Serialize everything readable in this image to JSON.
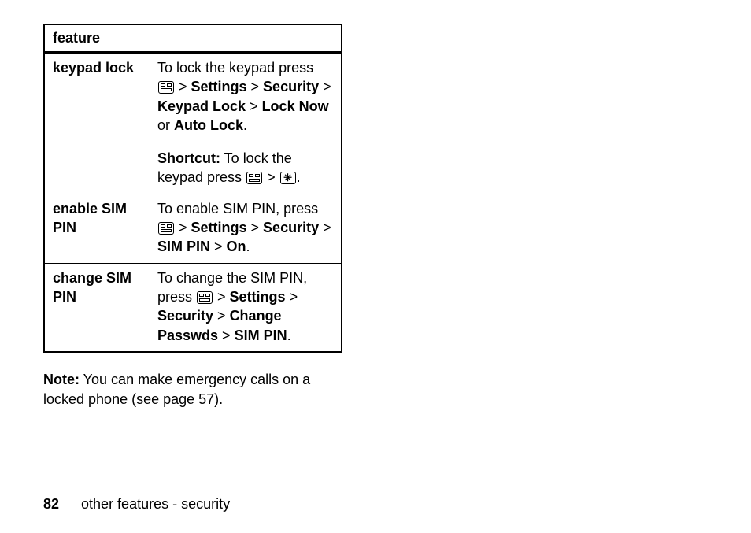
{
  "table": {
    "header": "feature",
    "rows": [
      {
        "feature": "keypad lock",
        "desc_pre": "To lock the keypad press ",
        "path1": "Settings",
        "path2": "Security",
        "path3": "Keypad Lock",
        "path4": "Lock Now",
        "conj": " or ",
        "path5": "Auto Lock",
        "period": ".",
        "shortcut_label": "Shortcut:",
        "shortcut_text": " To lock the keypad press ",
        "shortcut_end": "."
      },
      {
        "feature": "enable SIM PIN",
        "desc_pre": "To enable SIM PIN, press ",
        "path1": "Settings",
        "path2": "Security",
        "path3": "SIM PIN",
        "path4": "On",
        "period": "."
      },
      {
        "feature": "change SIM PIN",
        "desc_pre": "To change the SIM PIN, press ",
        "path1": "Settings",
        "path2": "Security",
        "path3": "Change Passwds",
        "path4": "SIM PIN",
        "period": "."
      }
    ]
  },
  "note": {
    "label": "Note:",
    "text": " You can make emergency calls on a locked phone (see page 57)."
  },
  "footer": {
    "page": "82",
    "section": "other features - security"
  },
  "gt": " > "
}
